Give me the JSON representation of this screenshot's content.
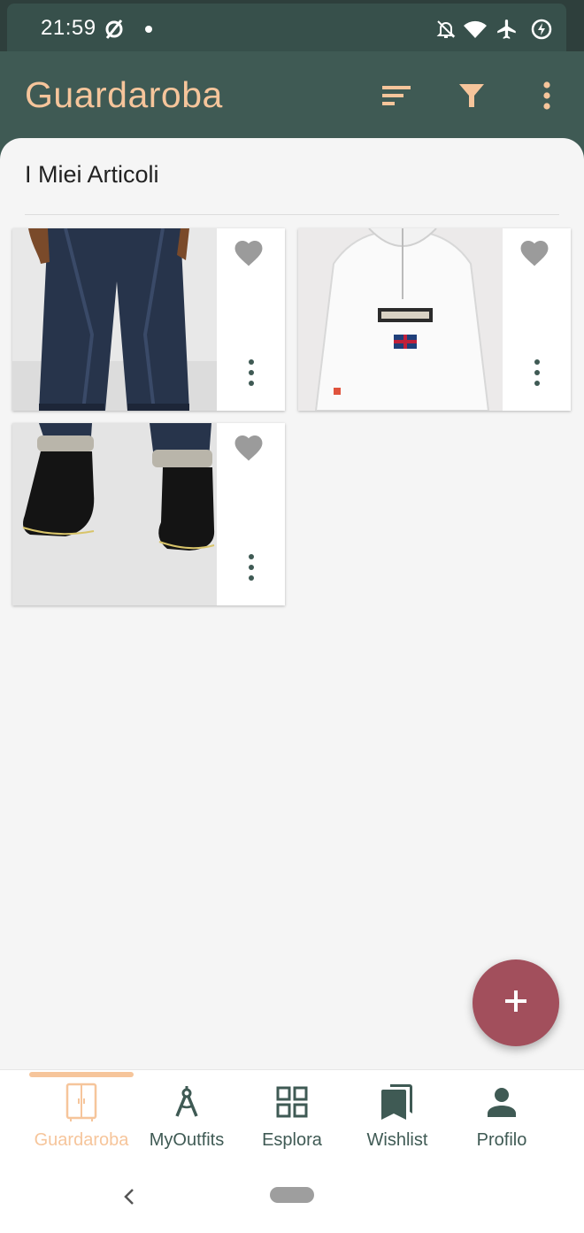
{
  "status_bar": {
    "time": "21:59",
    "icons": [
      "no-data-saver-icon",
      "dot-icon",
      "notifications-off-icon",
      "wifi-icon",
      "airplane-icon",
      "battery-charging-icon"
    ]
  },
  "app_bar": {
    "title": "Guardaroba",
    "actions": [
      "sort-icon",
      "filter-icon",
      "more-vert-icon"
    ]
  },
  "section": {
    "title": "I Miei Articoli"
  },
  "items": [
    {
      "name": "jeans",
      "favorite": false
    },
    {
      "name": "jacket",
      "favorite": false
    },
    {
      "name": "boots",
      "favorite": false
    }
  ],
  "fab": {
    "icon": "add-icon"
  },
  "bottom_nav": {
    "active": "Guardaroba",
    "items": [
      {
        "label": "Guardaroba",
        "icon": "wardrobe-icon"
      },
      {
        "label": "MyOutfits",
        "icon": "compass-icon"
      },
      {
        "label": "Esplora",
        "icon": "grid-icon"
      },
      {
        "label": "Wishlist",
        "icon": "bookmarks-icon"
      },
      {
        "label": "Profilo",
        "icon": "person-icon"
      }
    ]
  },
  "colors": {
    "primary": "#3f5a54",
    "accent": "#f6c59b",
    "fab": "#a24f5c",
    "background": "#f5f5f5"
  }
}
